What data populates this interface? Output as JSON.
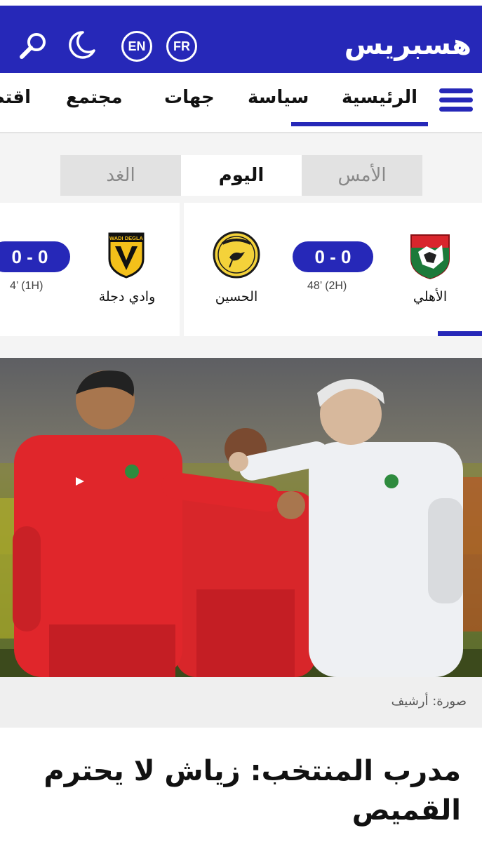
{
  "header": {
    "logo_text": "هسبريس",
    "lang_en": "EN",
    "lang_fr": "FR",
    "brand_color": "#2628b8"
  },
  "nav": {
    "items": [
      {
        "label": "الرئيسية",
        "active": true
      },
      {
        "label": "سياسة"
      },
      {
        "label": "جهات"
      },
      {
        "label": "مجتمع"
      },
      {
        "label": "اقتصاد"
      }
    ]
  },
  "day_tabs": {
    "yesterday": "الأمس",
    "today": "اليوم",
    "tomorrow": "الغد",
    "selected": "today"
  },
  "matches": [
    {
      "home": "الأهلي",
      "away": "الحسين",
      "score": "0 - 0",
      "minute": "48’ (2H)",
      "away_crest_text": "نادي الحسين الرياضي"
    },
    {
      "home": "وادي دجلة",
      "away": "",
      "score": "0 - 0",
      "minute": "4’ (1H)",
      "home_crest_text": "WADI DEGLA"
    }
  ],
  "hero": {
    "caption": "صورة: أرشيف"
  },
  "article": {
    "headline": "مدرب المنتخب: زياش لا يحترم القميص"
  }
}
